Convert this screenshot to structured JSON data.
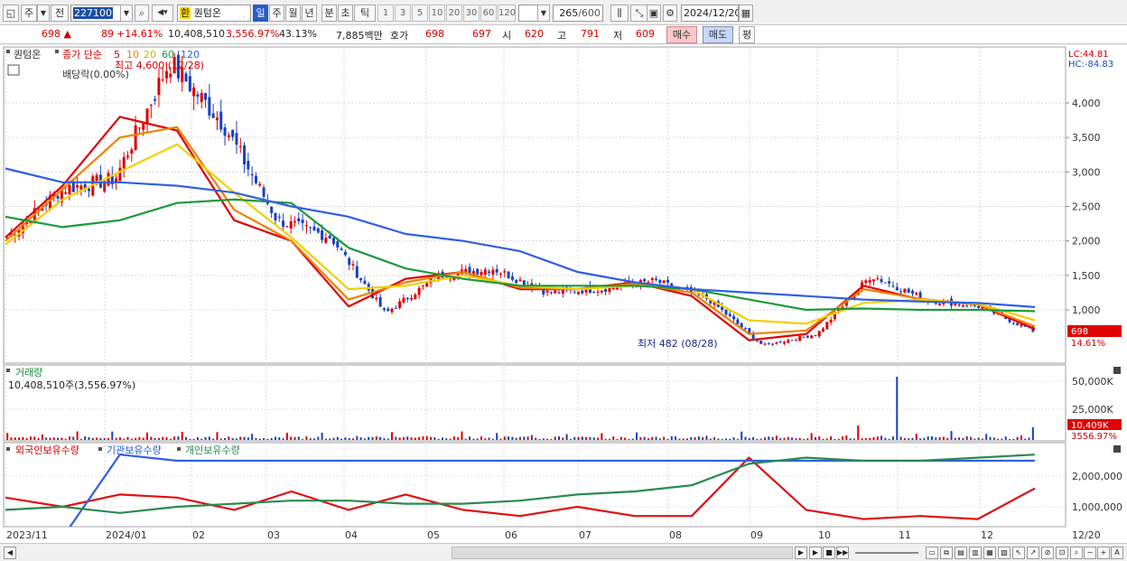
{
  "toolbar": {
    "code_prefix_1": "주",
    "code_prefix_2": "전",
    "stock_code": "227100",
    "stock_name_badge": "환",
    "stock_name": "퀀텀온",
    "period_day": "일",
    "period_week": "주",
    "period_month": "월",
    "period_year": "년",
    "period_minute": "분",
    "period_second": "초",
    "period_tick": "틱",
    "intervals": [
      "1",
      "3",
      "5",
      "10",
      "20",
      "30",
      "60",
      "120"
    ],
    "bar_count": "265",
    "bar_count_max": "/600",
    "date": "2024/12/20"
  },
  "quote": {
    "price": "698",
    "change_arrow": "▲",
    "change": "89",
    "change_pct": "+14.61%",
    "volume": "10,408,510",
    "volume_ratio": "3,556.97%",
    "turnover": "43.13%",
    "amount": "7,885백만",
    "hoga_label": "호가",
    "ask": "698",
    "bid": "697",
    "open_label": "시",
    "open": "620",
    "high_label": "고",
    "high": "791",
    "low_label": "저",
    "low": "609",
    "buy_button": "매수",
    "sell_button": "매도",
    "eval_button": "평"
  },
  "price_panel": {
    "title": "퀀텀온",
    "ma_label": "종가 단순",
    "ma_periods": [
      "5",
      "10",
      "20",
      "60",
      "120"
    ],
    "ma_colors": [
      "#e00000",
      "#f08000",
      "#f0d000",
      "#1a9a3a",
      "#3060e0"
    ],
    "high_note": "최고 4,600 (12/28)",
    "dividend_note": "배당락(0.00%)",
    "low_note": "최저 482 (08/28)",
    "lc": "LC:44.81",
    "hc": "HC:-84.83",
    "y_ticks": [
      "4,000",
      "3,500",
      "3,000",
      "2,500",
      "2,000",
      "1,500",
      "1,000"
    ],
    "current_price_tag": "698",
    "current_pct_tag": "14.61%"
  },
  "volume_panel": {
    "title": "거래량",
    "info": "10,408,510주(3,556.97%)",
    "y_ticks": [
      "50,000K",
      "25,000K"
    ],
    "current_tag": "10,409K",
    "current_pct_tag": "3556.97%"
  },
  "holding_panel": {
    "foreign_label": "외국인보유수량",
    "institution_label": "기관보유수량",
    "individual_label": "개인보유수량",
    "foreign_color": "#e01010",
    "institution_color": "#3060e0",
    "individual_color": "#2a8a50",
    "y_ticks": [
      "2,000,000",
      "1,000,000"
    ]
  },
  "x_axis": {
    "labels": [
      "2023/11",
      "2024/01",
      "02",
      "03",
      "04",
      "05",
      "06",
      "07",
      "08",
      "09",
      "10",
      "11",
      "12"
    ],
    "current_date": "12/20"
  },
  "chart_data": {
    "type": "candlestick",
    "x_range": [
      "2023/11",
      "2024/12/20"
    ],
    "ylim": [
      450,
      4600
    ],
    "close_approx": [
      [
        "2023/11",
        2050
      ],
      [
        "2023/12/05",
        2750
      ],
      [
        "2023/12/15",
        2900
      ],
      [
        "2023/12/28",
        4600
      ],
      [
        "2024/01/10",
        3700
      ],
      [
        "2024/01/20",
        2300
      ],
      [
        "2024/02",
        2050
      ],
      [
        "2024/03/05",
        950
      ],
      [
        "2024/03/20",
        1500
      ],
      [
        "2024/04",
        1600
      ],
      [
        "2024/05",
        1250
      ],
      [
        "2024/06",
        1300
      ],
      [
        "2024/07",
        1420
      ],
      [
        "2024/08/20",
        1150
      ],
      [
        "2024/08/28",
        482
      ],
      [
        "2024/09/20",
        650
      ],
      [
        "2024/10/01",
        1500
      ],
      [
        "2024/11",
        1150
      ],
      [
        "2024/12/01",
        1050
      ],
      [
        "2024/12/20",
        698
      ]
    ],
    "series": [
      {
        "name": "5",
        "values": [
          2050,
          2800,
          3800,
          3600,
          2300,
          2000,
          1050,
          1450,
          1550,
          1300,
          1300,
          1400,
          1200,
          560,
          650,
          1350,
          1150,
          1080,
          720
        ]
      },
      {
        "name": "10",
        "values": [
          2000,
          2750,
          3500,
          3650,
          2450,
          2000,
          1150,
          1400,
          1550,
          1320,
          1300,
          1380,
          1250,
          650,
          700,
          1300,
          1160,
          1080,
          760
        ]
      },
      {
        "name": "20",
        "values": [
          1950,
          2600,
          3000,
          3400,
          2700,
          2050,
          1300,
          1350,
          1500,
          1350,
          1300,
          1350,
          1300,
          850,
          800,
          1100,
          1150,
          1090,
          850
        ]
      },
      {
        "name": "60",
        "values": [
          2350,
          2200,
          2300,
          2550,
          2600,
          2550,
          1900,
          1600,
          1450,
          1350,
          1350,
          1350,
          1300,
          1150,
          1000,
          1020,
          1000,
          1000,
          980
        ]
      },
      {
        "name": "120",
        "values": [
          3050,
          2850,
          2850,
          2800,
          2700,
          2500,
          2350,
          2100,
          2000,
          1850,
          1550,
          1400,
          1300,
          1250,
          1200,
          1150,
          1120,
          1100,
          1040
        ]
      }
    ],
    "holding_series": [
      {
        "name": "외국인보유수량",
        "values": [
          1300000,
          1000000,
          1400000,
          1300000,
          900000,
          1500000,
          900000,
          1400000,
          900000,
          700000,
          1000000,
          700000,
          700000,
          2600000,
          900000,
          600000,
          700000,
          600000,
          1600000
        ]
      },
      {
        "name": "기관보유수량",
        "values": [
          0,
          0,
          2700000,
          2500000,
          2500000,
          2500000,
          2500000,
          2500000,
          2500000,
          2500000,
          2500000,
          2500000,
          2500000,
          2500000,
          2500000,
          2500000,
          2500000,
          2500000,
          2500000
        ]
      },
      {
        "name": "개인보유수량",
        "values": [
          900000,
          1000000,
          800000,
          1000000,
          1100000,
          1200000,
          1200000,
          1100000,
          1100000,
          1200000,
          1400000,
          1500000,
          1700000,
          2400000,
          2600000,
          2500000,
          2500000,
          2600000,
          2700000
        ]
      }
    ]
  }
}
